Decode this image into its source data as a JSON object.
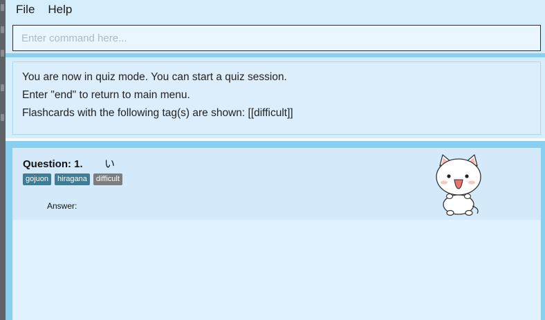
{
  "menu": {
    "items": [
      {
        "label": "File"
      },
      {
        "label": "Help"
      }
    ]
  },
  "command": {
    "placeholder": "Enter command here...",
    "value": ""
  },
  "result": {
    "lines": [
      "You are now in quiz mode. You can start a quiz session.",
      "Enter \"end\" to return to main menu.",
      "Flashcards with the following tag(s) are shown: [[difficult]]"
    ]
  },
  "flashcard": {
    "question_label": "Question: 1.",
    "question_text": "い",
    "tags": [
      {
        "label": "gojuon",
        "color": "#3d7e96"
      },
      {
        "label": "hiragana",
        "color": "#3d7e96"
      },
      {
        "label": "difficult",
        "color": "#7d7d7d"
      }
    ],
    "answer_label": "Answer:",
    "mascot_icon": "cat-mascot-icon"
  },
  "colors": {
    "panel_border": "#89cff0",
    "panel_background": "#d6eefc",
    "card_background": "#d4eafb"
  }
}
